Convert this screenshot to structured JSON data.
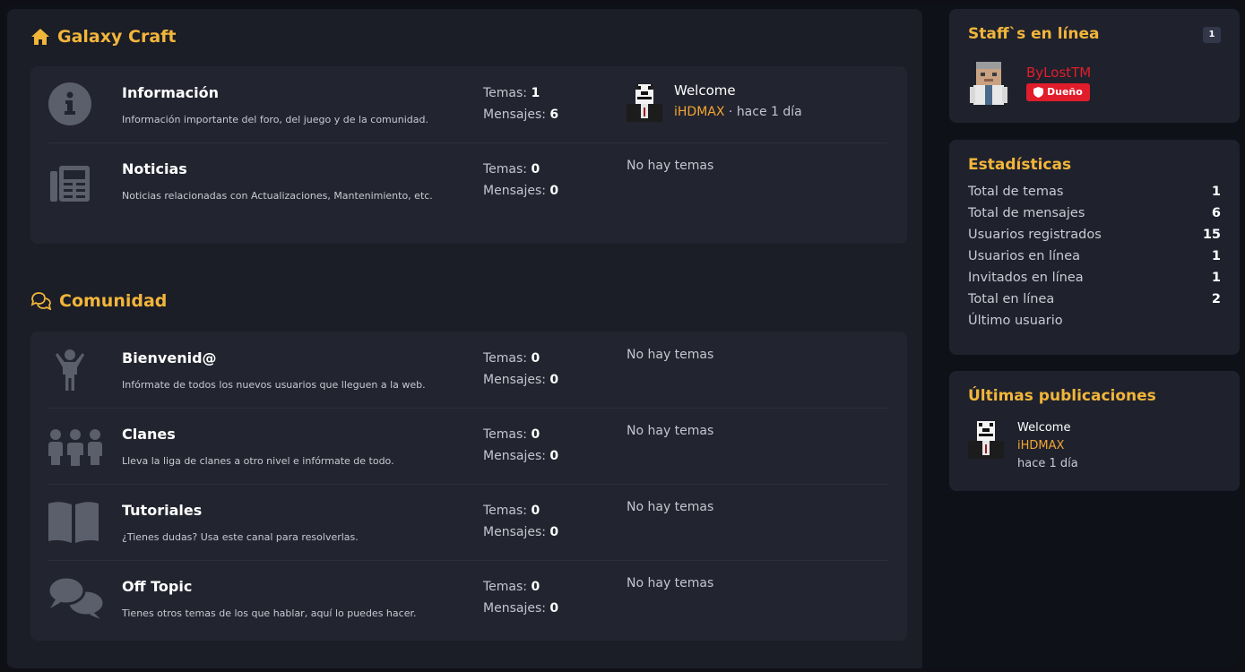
{
  "colors": {
    "accent": "#f2b53a",
    "link": "#f2a531",
    "danger": "#e11d2b",
    "panel": "#22242f",
    "card": "#1f222d"
  },
  "sections": [
    {
      "title": "Galaxy Craft",
      "icon": "home-icon",
      "forums": [
        {
          "name": "Información",
          "description": "Información importante del foro, del juego y de la comunidad.",
          "icon": "info-icon",
          "temas_label": "Temas:",
          "temas": "1",
          "mensajes_label": "Mensajes:",
          "mensajes": "6",
          "latest": {
            "title": "Welcome",
            "user": "iHDMAX",
            "separator": " · ",
            "time": "hace 1 día"
          }
        },
        {
          "name": "Noticias",
          "description": "Noticias relacionadas con Actualizaciones, Mantenimiento, etc.",
          "icon": "newspaper-icon",
          "temas_label": "Temas:",
          "temas": "0",
          "mensajes_label": "Mensajes:",
          "mensajes": "0",
          "empty": "No hay temas"
        }
      ]
    },
    {
      "title": "Comunidad",
      "icon": "chat-icon",
      "forums": [
        {
          "name": "Bienvenid@",
          "description": "Infórmate de todos los nuevos usuarios que lleguen a la web.",
          "icon": "person-wave-icon",
          "temas_label": "Temas:",
          "temas": "0",
          "mensajes_label": "Mensajes:",
          "mensajes": "0",
          "empty": "No hay temas"
        },
        {
          "name": "Clanes",
          "description": "Lleva la liga de clanes a otro nivel e infórmate de todo.",
          "icon": "group-icon",
          "temas_label": "Temas:",
          "temas": "0",
          "mensajes_label": "Mensajes:",
          "mensajes": "0",
          "empty": "No hay temas"
        },
        {
          "name": "Tutoriales",
          "description": "¿Tienes dudas? Usa este canal para resolverlas.",
          "icon": "book-icon",
          "temas_label": "Temas:",
          "temas": "0",
          "mensajes_label": "Mensajes:",
          "mensajes": "0",
          "empty": "No hay temas"
        },
        {
          "name": "Off Topic",
          "description": "Tienes otros temas de los que hablar, aquí lo puedes hacer.",
          "icon": "comments-icon",
          "temas_label": "Temas:",
          "temas": "0",
          "mensajes_label": "Mensajes:",
          "mensajes": "0",
          "empty": "No hay temas"
        }
      ]
    }
  ],
  "staff": {
    "title": "Staff`s en línea",
    "count": "1",
    "user": "ByLostTM",
    "role": "Dueño"
  },
  "stats": {
    "title": "Estadísticas",
    "items": [
      {
        "label": "Total de temas",
        "value": "1"
      },
      {
        "label": "Total de mensajes",
        "value": "6"
      },
      {
        "label": "Usuarios registrados",
        "value": "15"
      },
      {
        "label": "Usuarios en línea",
        "value": "1"
      },
      {
        "label": "Invitados en línea",
        "value": "1"
      },
      {
        "label": "Total en línea",
        "value": "2"
      },
      {
        "label": "Último usuario",
        "value": ""
      }
    ]
  },
  "recent": {
    "title": "Últimas publicaciones",
    "post_title": "Welcome",
    "user": "iHDMAX",
    "time": "hace 1 día"
  }
}
